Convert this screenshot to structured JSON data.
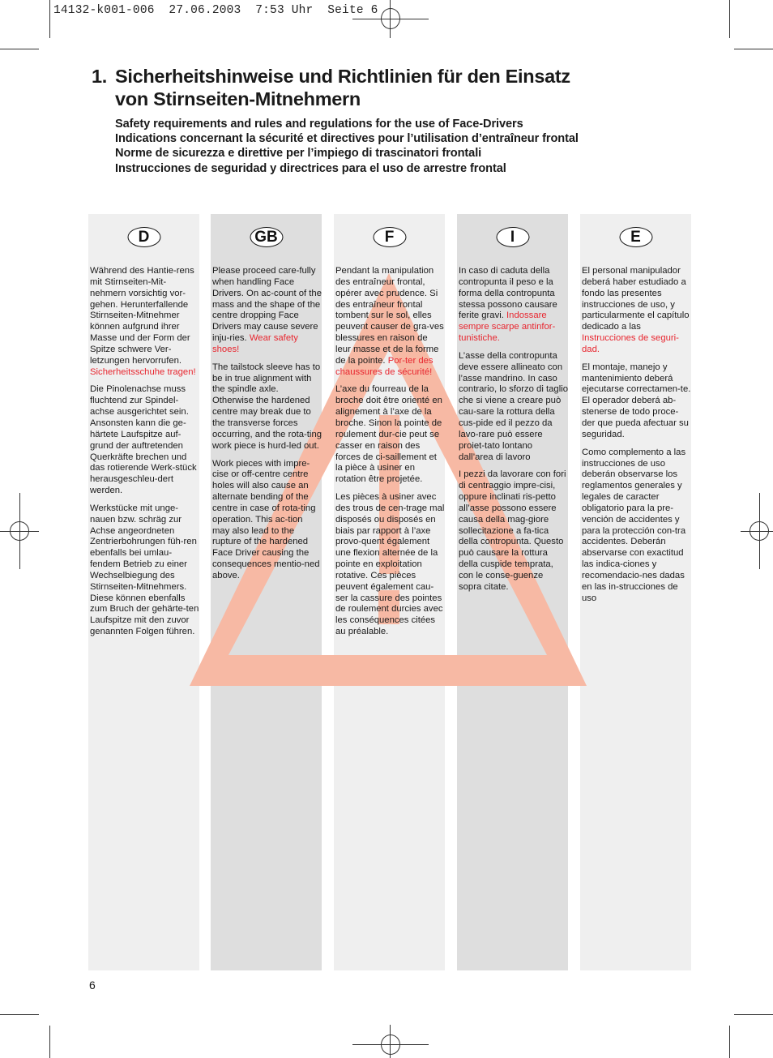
{
  "slug_line": "14132-k001-006  27.06.2003  7:53 Uhr  Seite 6",
  "title": {
    "number": "1.",
    "line1": "Sicherheitshinweise und Richtlinien für den Einsatz",
    "line2": "von Stirnseiten-Mitnehmern"
  },
  "subtitles": [
    "Safety requirements and rules and regulations for the use of Face-Drivers",
    "Indications concernant la sécurité et directives pour l’utilisation d’entraîneur frontal",
    "Norme de sicurezza e direttive per l’impiego di trascinatori frontali",
    "Instrucciones de seguridad y directrices para el uso de arrestre frontal"
  ],
  "colors": {
    "warning_red": "#e8262f",
    "triangle": "#f7b9a4",
    "column_light": "#efefef",
    "column_dark": "#dedede"
  },
  "warning_icon": "warning-triangle-exclamation-icon",
  "columns": [
    {
      "code": "D",
      "paragraphs": [
        {
          "text": "Während des Hantie-rens mit Stirnseiten-Mit-nehmern vorsichtig vor-gehen. Herunterfallende Stirnseiten-Mitnehmer können aufgrund ihrer Masse und der Form der Spitze schwere Ver-letzungen hervorrufen. ",
          "warning": "Sicherheitsschuhe tragen!"
        },
        {
          "text": "Die Pinolenachse muss fluchtend zur Spindel-achse ausgerichtet sein. Ansonsten kann die ge-härtete Laufspitze auf-grund der auftretenden Querkräfte brechen und das rotierende Werk-stück herausgeschleu-dert werden.",
          "warning": ""
        },
        {
          "text": "Werkstücke mit unge-nauen bzw. schräg zur Achse angeordneten Zentrierbohrungen füh-ren ebenfalls bei umlau-fendem Betrieb zu einer Wechselbiegung des Stirnseiten-Mitnehmers. Diese können ebenfalls zum Bruch der gehärte-ten Laufspitze mit den zuvor genannten Folgen führen.",
          "warning": ""
        }
      ]
    },
    {
      "code": "GB",
      "paragraphs": [
        {
          "text": "Please proceed care-fully when handling Face Drivers. On ac-count of the mass and the shape of the centre dropping Face Drivers may cause severe inju-ries. ",
          "warning": "Wear safety shoes!"
        },
        {
          "text": "The tailstock sleeve has to be in true alignment with the spindle axle. Otherwise the hardened centre may break due to the transverse forces occurring, and the rota-ting work piece is hurd-led out.",
          "warning": ""
        },
        {
          "text": "Work pieces with impre-cise or off-centre centre holes will also cause an alternate bending of the centre in case of rota-ting operation. This ac-tion may also lead to the rupture of the hardened Face Driver causing the consequences mentio-ned above.",
          "warning": ""
        }
      ]
    },
    {
      "code": "F",
      "paragraphs": [
        {
          "text": "Pendant la manipulation des entraîneur frontal, opérer avec prudence. Si des entraîneur frontal tombent sur le sol, elles peuvent causer de gra-ves blessures en raison de leur masse et de la forme de la pointe. ",
          "warning": "Por-ter des chaussures de sécurité!"
        },
        {
          "text": "L’axe du fourreau de la broche doit être orienté en alignement à l’axe de la broche. Sinon la pointe de roulement dur-cie peut se casser en raison des forces de ci-saillement et la pièce à usiner en rotation être projetée.",
          "warning": ""
        },
        {
          "text": "Les pièces à usiner avec des trous de cen-trage mal disposés ou disposés en biais par rapport à l’axe provo-quent également une flexion alternée de la pointe en exploitation rotative. Ces pièces peuvent également cau-ser la cassure des pointes de roulement durcies avec les conséquences citées au préalable.",
          "warning": ""
        }
      ]
    },
    {
      "code": "I",
      "paragraphs": [
        {
          "text": "In caso di caduta della contropunta il peso e la forma della contropunta stessa possono causare ferite gravi. ",
          "warning": "Indossare sempre scarpe antinfor-tunistiche."
        },
        {
          "text": "L’asse della contropunta deve essere allineato con l’asse mandrino. In caso contrario, lo sforzo di taglio che si viene a creare può cau-sare la rottura della cus-pide ed il pezzo da lavo-rare può essere proiet-tato lontano dall’area di lavoro",
          "warning": ""
        },
        {
          "text": "I pezzi da lavorare con fori di centraggio impre-cisi, oppure inclinati ris-petto all’asse possono essere causa della mag-giore sollecitazione a fa-tica della contropunta. Questo può causare la rottura della cuspide temprata, con le conse-guenze sopra citate.",
          "warning": ""
        }
      ]
    },
    {
      "code": "E",
      "paragraphs": [
        {
          "text": "El personal manipulador deberá haber estudiado a fondo las presentes instrucciones de uso, y particularmente el capítulo dedicado a las ",
          "warning": "Instrucciones de seguri-dad."
        },
        {
          "text": "El montaje, manejo y mantenimiento deberá ejecutarse correctamen-te. El operador deberá ab-stenerse de todo proce-der que pueda afectuar su seguridad.",
          "warning": ""
        },
        {
          "text": "Como complemento a las instrucciones de uso deberán observarse los reglamentos generales y legales de caracter obligatorio para la pre-vención de accidentes y para la protección con-tra accidentes. Deberán abservarse con exactitud las indica-ciones y recomendacio-nes dadas en las in-strucciones de uso",
          "warning": ""
        }
      ]
    }
  ],
  "page_number": "6"
}
